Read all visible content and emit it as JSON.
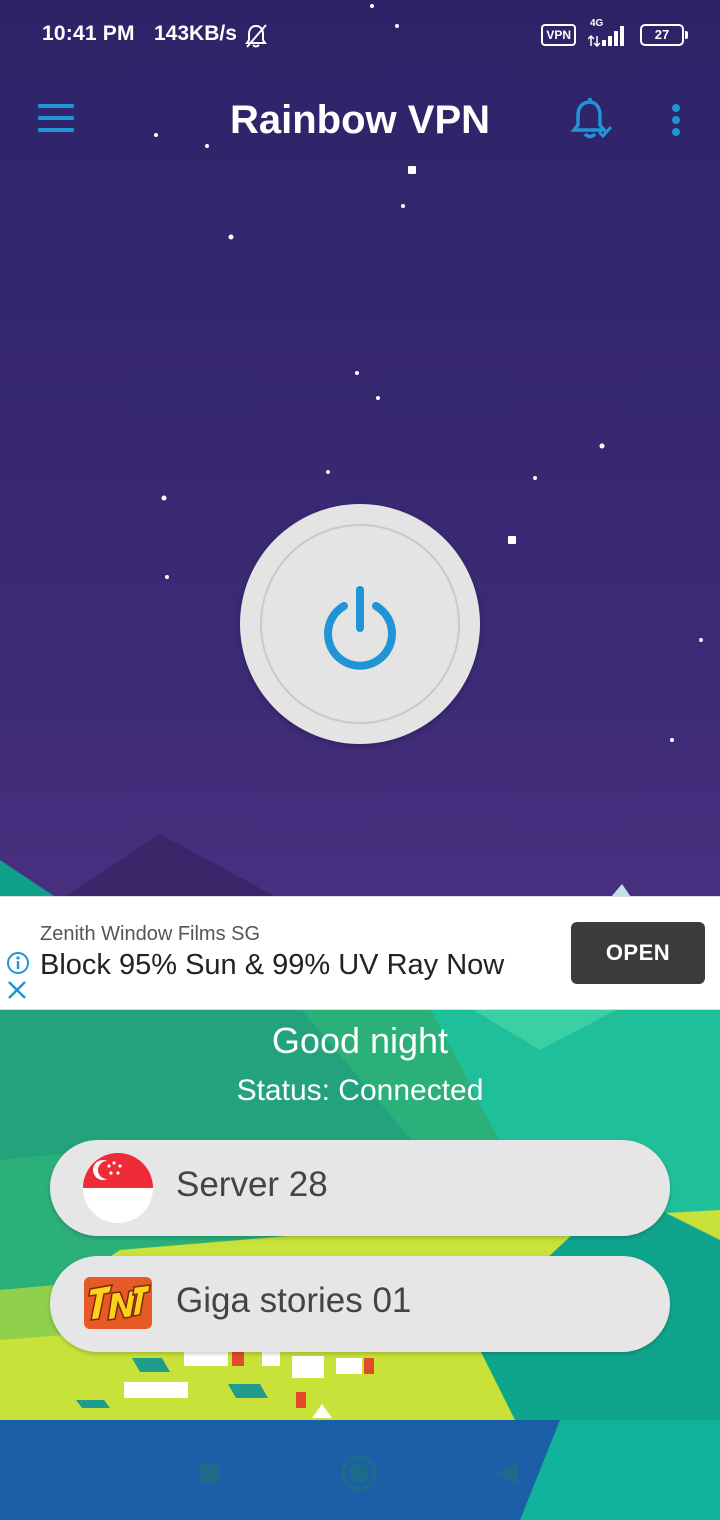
{
  "status_bar": {
    "time": "10:41 PM",
    "speed": "143KB/s",
    "icons": [
      "bell-off-icon",
      "vpn-icon",
      "signal-4g-icon",
      "battery-icon"
    ],
    "vpn_label": "VPN",
    "network_label": "4G",
    "battery": "27"
  },
  "toolbar": {
    "title": "Rainbow VPN",
    "icons": [
      "menu-icon",
      "bell-check-icon",
      "more-vertical-icon"
    ]
  },
  "power_button": {
    "icon": "power-icon"
  },
  "ad": {
    "advertiser": "Zenith Window Films SG",
    "headline": "Block 95% Sun & 99% UV Ray Now",
    "cta": "OPEN",
    "icons": [
      "info-icon",
      "close-icon"
    ]
  },
  "greeting": "Good night",
  "status": "Status: Connected",
  "server": {
    "label": "Server 28",
    "icon": "singapore-flag-icon"
  },
  "network": {
    "label": "Giga stories 01",
    "icon": "tnt-logo-icon"
  },
  "nav": {
    "icons": [
      "recents-icon",
      "home-icon",
      "back-icon"
    ]
  },
  "colors": {
    "accent": "#1f95d6",
    "sky": "#3d2b77",
    "pill": "#e6e6e6",
    "ad_button": "#3b3b3b"
  }
}
